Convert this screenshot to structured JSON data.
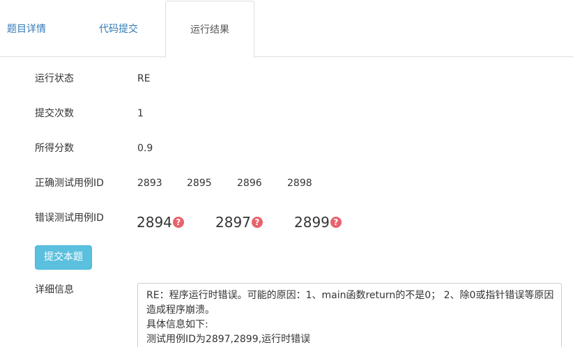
{
  "tabs": [
    {
      "label": "题目详情"
    },
    {
      "label": "代码提交"
    },
    {
      "label": "运行结果"
    }
  ],
  "active_tab": "运行结果",
  "result": {
    "status_label": "运行状态",
    "status_value": "RE",
    "submit_count_label": "提交次数",
    "submit_count_value": "1",
    "score_label": "所得分数",
    "score_value": "0.9",
    "correct_label": "正确测试用例ID",
    "correct_ids": [
      "2893",
      "2895",
      "2896",
      "2898"
    ],
    "wrong_label": "错误测试用例ID",
    "wrong_ids": [
      "2894",
      "2897",
      "2899"
    ],
    "help_glyph": "?"
  },
  "submit_button_label": "提交本题",
  "detail": {
    "label": "详细信息",
    "lines": [
      "RE：程序运行时错误。可能的原因：1、main函数return的不是0； 2、除0或指针错误等原因",
      "造成程序崩溃。",
      "具体信息如下:",
      "测试用例ID为2897,2899,运行时错误"
    ]
  },
  "colors": {
    "link": "#337ab7",
    "active_tab_text": "#555555",
    "button_bg": "#5bc0de",
    "help_icon": "#e8636b",
    "border": "#dddddd"
  },
  "icons": [
    "question-circle-icon"
  ]
}
